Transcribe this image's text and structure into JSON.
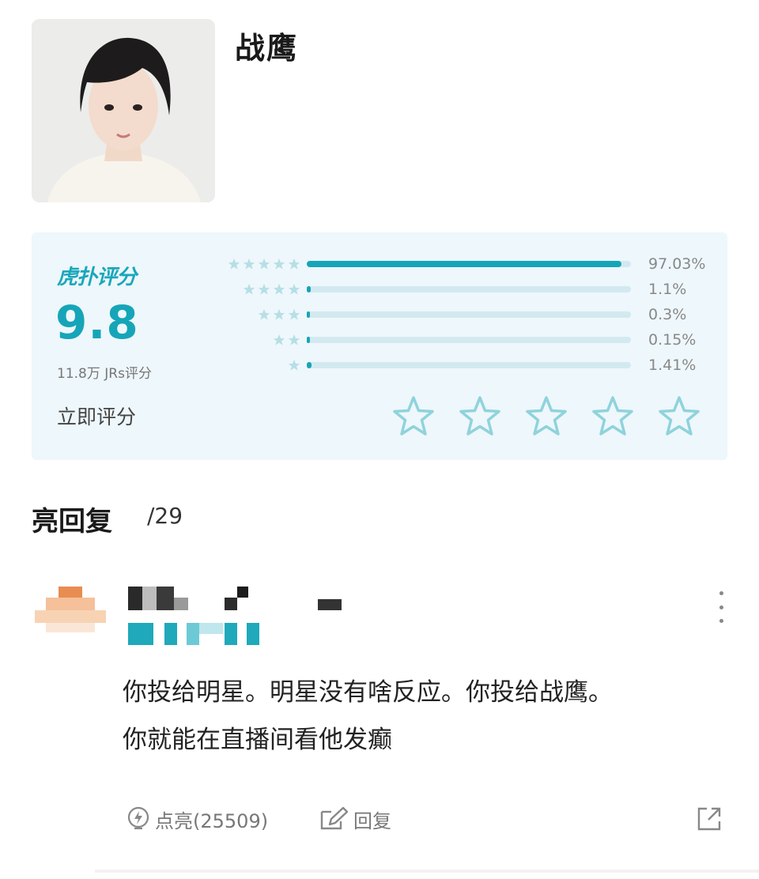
{
  "profile": {
    "name": "战鹰",
    "photo_alt": "avatar-photo"
  },
  "rating": {
    "brand": "虎扑评分",
    "score": "9.8",
    "count": "11.8万 JRs评分",
    "rate_now": "立即评分",
    "distribution": [
      {
        "stars": 5,
        "percent": 97.03,
        "label": "97.03%"
      },
      {
        "stars": 4,
        "percent": 1.1,
        "label": "1.1%"
      },
      {
        "stars": 3,
        "percent": 0.3,
        "label": "0.3%"
      },
      {
        "stars": 2,
        "percent": 0.15,
        "label": "0.15%"
      },
      {
        "stars": 1,
        "percent": 1.41,
        "label": "1.41%"
      }
    ],
    "accent_color": "#16a5b8",
    "track_color": "#d3e9f0"
  },
  "replies": {
    "title": "亮回复",
    "count": "/29"
  },
  "comment": {
    "line1": "你投给明星。明星没有啥反应。你投给战鹰。",
    "line2": "你就能在直播间看他发癫",
    "like_label": "点亮(25509)",
    "reply_label": "回复",
    "icons": [
      "lightning-icon",
      "edit-icon",
      "share-icon",
      "more-icon"
    ]
  }
}
